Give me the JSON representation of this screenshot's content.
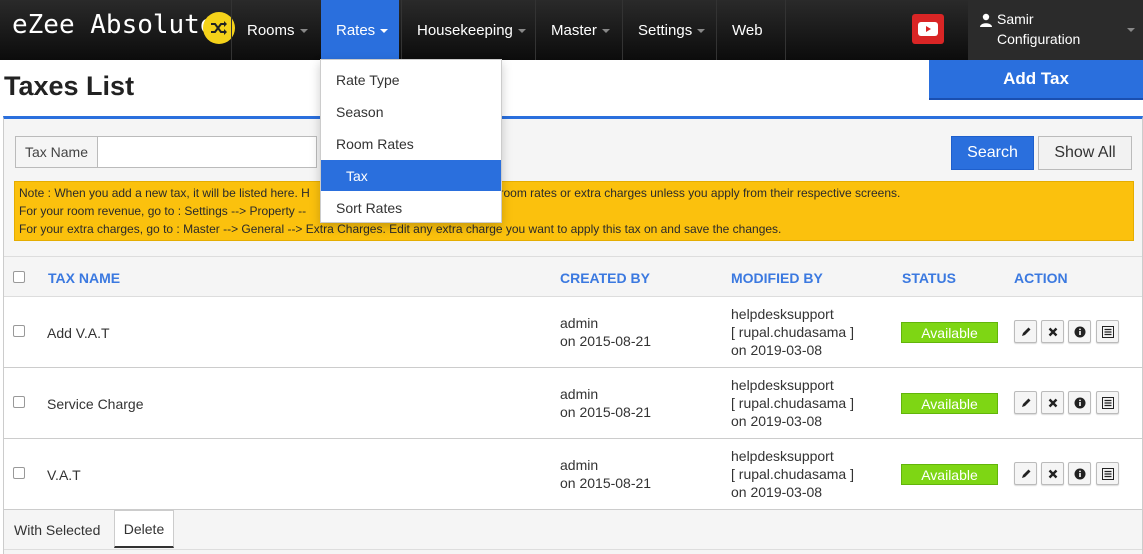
{
  "brand": {
    "name": "eZee Absolute",
    "badge_icon": "shuffle-icon",
    "badge_color": "#f5d21a"
  },
  "nav": {
    "items": [
      {
        "label": "Rooms",
        "dropdown": true
      },
      {
        "label": "Rates",
        "dropdown": true,
        "active": true
      },
      {
        "label": "Housekeeping",
        "dropdown": true
      },
      {
        "label": "Master",
        "dropdown": true
      },
      {
        "label": "Settings",
        "dropdown": true
      },
      {
        "label": "Web",
        "dropdown": false
      }
    ],
    "youtube_icon": "youtube-icon",
    "user": {
      "name": "Samir",
      "role": "Configuration"
    },
    "active_color": "#2a6fdd"
  },
  "rates_menu": {
    "items": [
      "Rate Type",
      "Season",
      "Room Rates",
      "Tax",
      "Sort Rates"
    ],
    "active": "Tax"
  },
  "page": {
    "title": "Taxes List",
    "add_button": "Add Tax"
  },
  "search": {
    "label": "Tax Name",
    "value": "",
    "placeholder": "",
    "search_button": "Search",
    "show_all_button": "Show All"
  },
  "note": {
    "line1": "Note : When you add a new tax, it will be listed here. H",
    "line1_end": "n your room rates or extra charges unless you apply from their respective screens.",
    "line2": "For your room revenue, go to : Settings --> Property --",
    "line3": "For your extra charges, go to : Master --> General --> Extra Charges. Edit any extra charge you want to apply this tax on and save the changes.",
    "color": "#fbc10d"
  },
  "table": {
    "headers": {
      "tax_name": "TAX NAME",
      "created_by": "CREATED BY",
      "modified_by": "MODIFIED BY",
      "status": "STATUS",
      "action": "ACTION"
    },
    "rows": [
      {
        "name": "Add V.A.T",
        "created_user": "admin",
        "created_on": "on 2015-08-21",
        "modified_user": "helpdesksupport",
        "modified_sub": "[ rupal.chudasama ]",
        "modified_on": "on 2019-03-08",
        "status": "Available"
      },
      {
        "name": "Service Charge",
        "created_user": "admin",
        "created_on": "on 2015-08-21",
        "modified_user": "helpdesksupport",
        "modified_sub": "[ rupal.chudasama ]",
        "modified_on": "on 2019-03-08",
        "status": "Available"
      },
      {
        "name": "V.A.T",
        "created_user": "admin",
        "created_on": "on 2015-08-21",
        "modified_user": "helpdesksupport",
        "modified_sub": "[ rupal.chudasama ]",
        "modified_on": "on 2019-03-08",
        "status": "Available"
      }
    ],
    "action_icons": [
      "pencil-icon",
      "close-icon",
      "info-icon",
      "list-icon"
    ],
    "status_color": "#7ed614"
  },
  "footer": {
    "with_selected": "With Selected",
    "delete": "Delete"
  }
}
